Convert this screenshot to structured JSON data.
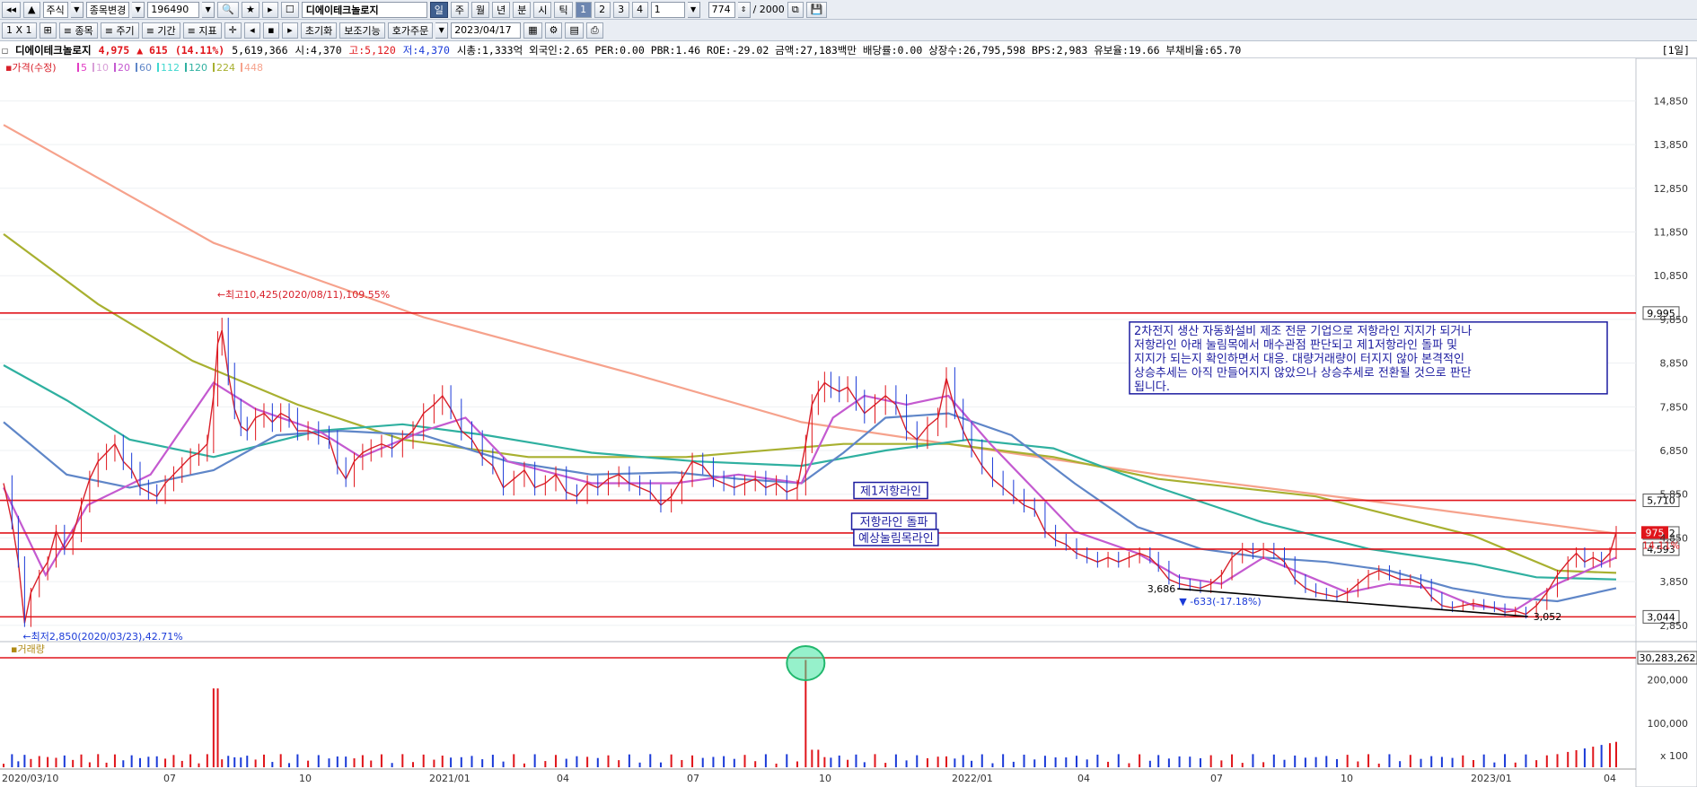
{
  "toolbar1": {
    "market": "주식",
    "change_label": "종목변경",
    "code": "196490",
    "name": "디에이테크놀로지",
    "periods": [
      "일",
      "주",
      "월",
      "년",
      "분",
      "시",
      "틱"
    ],
    "numbers": [
      "1",
      "2",
      "3",
      "4"
    ],
    "unit": "1",
    "count": "774",
    "total": "/ 2000"
  },
  "toolbar2": {
    "buttons": [
      "1 X 1",
      "≡ 종목",
      "≡ 주기",
      "≡ 기간",
      "≡ 지표"
    ],
    "reset_label": "초기화",
    "aux_label": "보조기능",
    "order_label": "호가주문",
    "date": "2023/04/17"
  },
  "info": {
    "name": "디에이테크놀로지",
    "price": "4,975",
    "change": "▲ 615",
    "pct": "(14.11%)",
    "volume": "5,619,366",
    "open": "시:4,370",
    "high": "고:5,120",
    "low": "저:4,370",
    "rest": "시총:1,333억 외국인:2.65 PER:0.00 PBR:1.46 ROE:-29.02 금액:27,183백만 배당률:0.00 상장수:26,795,598 BPS:2,983 유보율:19.66 부채비율:65.70",
    "period_tag": "[1일]"
  },
  "chart_data": {
    "type": "line",
    "title": "",
    "price_legend": "가격(수정)",
    "ma_legend": [
      {
        "name": "5",
        "color": "#e23cc4"
      },
      {
        "name": "10",
        "color": "#d9a0d8"
      },
      {
        "name": "20",
        "color": "#c45ad0"
      },
      {
        "name": "60",
        "color": "#5f86c8"
      },
      {
        "name": "112",
        "color": "#40d8d0"
      },
      {
        "name": "120",
        "color": "#2fb0a0"
      },
      {
        "name": "224",
        "color": "#a8b030"
      },
      {
        "name": "448",
        "color": "#f6a28c"
      }
    ],
    "volume_legend": "거래량",
    "x_ticks": [
      "2020/03/10",
      "07",
      "10",
      "2021/01",
      "04",
      "07",
      "10",
      "2022/01",
      "04",
      "07",
      "10",
      "2023/01",
      "04"
    ],
    "y_ticks": [
      "14,850",
      "13,850",
      "12,850",
      "11,850",
      "10,850",
      "9,850",
      "8,850",
      "7,850",
      "6,850",
      "5,850",
      "4,850",
      "3,850",
      "2,850"
    ],
    "ylim": [
      2600,
      15700
    ],
    "vol_ticks": [
      "200,000",
      "100,000",
      "x 100"
    ],
    "h_lines": [
      {
        "value": 9995,
        "label": "9,995"
      },
      {
        "value": 5710,
        "label": "5,710"
      },
      {
        "value": 4962,
        "label": "4,962"
      },
      {
        "value": 4593,
        "label": "4,593"
      },
      {
        "value": 3044,
        "label": "3,044"
      }
    ],
    "last_tag_value": "975",
    "last_tag_pct": "14.11%",
    "vol_hline_label": "30,283,262",
    "price_path": [
      [
        0,
        6100
      ],
      [
        8,
        5200
      ],
      [
        14,
        4300
      ],
      [
        20,
        2900
      ],
      [
        26,
        3600
      ],
      [
        34,
        4000
      ],
      [
        42,
        4300
      ],
      [
        50,
        5000
      ],
      [
        58,
        4600
      ],
      [
        66,
        4900
      ],
      [
        74,
        5600
      ],
      [
        82,
        6200
      ],
      [
        90,
        6600
      ],
      [
        98,
        6800
      ],
      [
        106,
        7000
      ],
      [
        114,
        6600
      ],
      [
        122,
        6400
      ],
      [
        130,
        6000
      ],
      [
        138,
        5900
      ],
      [
        146,
        5800
      ],
      [
        154,
        6100
      ],
      [
        162,
        6300
      ],
      [
        170,
        6500
      ],
      [
        178,
        6700
      ],
      [
        186,
        6800
      ],
      [
        194,
        7000
      ],
      [
        200,
        8100
      ],
      [
        204,
        9300
      ],
      [
        208,
        9600
      ],
      [
        214,
        8600
      ],
      [
        220,
        7800
      ],
      [
        226,
        7400
      ],
      [
        232,
        7300
      ],
      [
        240,
        7600
      ],
      [
        248,
        7700
      ],
      [
        256,
        7500
      ],
      [
        264,
        7700
      ],
      [
        272,
        7600
      ],
      [
        280,
        7300
      ],
      [
        290,
        7300
      ],
      [
        300,
        7200
      ],
      [
        310,
        7100
      ],
      [
        318,
        6500
      ],
      [
        326,
        6200
      ],
      [
        334,
        6600
      ],
      [
        342,
        6800
      ],
      [
        350,
        6900
      ],
      [
        360,
        7000
      ],
      [
        370,
        6900
      ],
      [
        380,
        7100
      ],
      [
        390,
        7300
      ],
      [
        400,
        7700
      ],
      [
        410,
        7900
      ],
      [
        418,
        8100
      ],
      [
        426,
        7800
      ],
      [
        436,
        7300
      ],
      [
        446,
        7100
      ],
      [
        456,
        6700
      ],
      [
        466,
        6500
      ],
      [
        476,
        6000
      ],
      [
        486,
        6200
      ],
      [
        496,
        6400
      ],
      [
        506,
        6000
      ],
      [
        516,
        6100
      ],
      [
        526,
        6300
      ],
      [
        536,
        5900
      ],
      [
        546,
        5800
      ],
      [
        556,
        6100
      ],
      [
        566,
        6000
      ],
      [
        576,
        6200
      ],
      [
        586,
        6300
      ],
      [
        596,
        6100
      ],
      [
        606,
        6000
      ],
      [
        616,
        5900
      ],
      [
        626,
        5600
      ],
      [
        636,
        5800
      ],
      [
        646,
        6200
      ],
      [
        656,
        6600
      ],
      [
        666,
        6500
      ],
      [
        676,
        6200
      ],
      [
        686,
        6100
      ],
      [
        696,
        6000
      ],
      [
        706,
        6100
      ],
      [
        716,
        6200
      ],
      [
        726,
        6000
      ],
      [
        736,
        6100
      ],
      [
        746,
        5900
      ],
      [
        756,
        6000
      ],
      [
        764,
        7000
      ],
      [
        770,
        7900
      ],
      [
        776,
        8200
      ],
      [
        782,
        8400
      ],
      [
        788,
        8300
      ],
      [
        796,
        8200
      ],
      [
        804,
        8300
      ],
      [
        812,
        8000
      ],
      [
        820,
        7700
      ],
      [
        830,
        7900
      ],
      [
        840,
        8100
      ],
      [
        850,
        7900
      ],
      [
        860,
        7300
      ],
      [
        870,
        7100
      ],
      [
        880,
        7400
      ],
      [
        890,
        7600
      ],
      [
        898,
        8500
      ],
      [
        906,
        7800
      ],
      [
        914,
        7300
      ],
      [
        922,
        6900
      ],
      [
        932,
        6500
      ],
      [
        942,
        6200
      ],
      [
        952,
        6000
      ],
      [
        962,
        5800
      ],
      [
        972,
        5600
      ],
      [
        982,
        5500
      ],
      [
        992,
        5000
      ],
      [
        1002,
        4800
      ],
      [
        1012,
        4700
      ],
      [
        1022,
        4500
      ],
      [
        1032,
        4400
      ],
      [
        1042,
        4300
      ],
      [
        1052,
        4400
      ],
      [
        1062,
        4300
      ],
      [
        1072,
        4400
      ],
      [
        1082,
        4500
      ],
      [
        1092,
        4400
      ],
      [
        1100,
        4200
      ],
      [
        1110,
        3900
      ],
      [
        1120,
        3800
      ],
      [
        1130,
        3750
      ],
      [
        1140,
        3700
      ],
      [
        1150,
        3800
      ],
      [
        1160,
        4000
      ],
      [
        1170,
        4400
      ],
      [
        1180,
        4600
      ],
      [
        1190,
        4500
      ],
      [
        1200,
        4600
      ],
      [
        1210,
        4500
      ],
      [
        1220,
        4300
      ],
      [
        1230,
        3900
      ],
      [
        1240,
        3700
      ],
      [
        1250,
        3600
      ],
      [
        1260,
        3550
      ],
      [
        1270,
        3500
      ],
      [
        1280,
        3600
      ],
      [
        1290,
        3800
      ],
      [
        1300,
        4000
      ],
      [
        1310,
        4100
      ],
      [
        1320,
        4000
      ],
      [
        1330,
        3900
      ],
      [
        1340,
        3900
      ],
      [
        1350,
        3800
      ],
      [
        1360,
        3500
      ],
      [
        1370,
        3300
      ],
      [
        1380,
        3250
      ],
      [
        1390,
        3300
      ],
      [
        1400,
        3350
      ],
      [
        1410,
        3300
      ],
      [
        1420,
        3250
      ],
      [
        1430,
        3150
      ],
      [
        1440,
        3180
      ],
      [
        1450,
        3100
      ],
      [
        1460,
        3300
      ],
      [
        1470,
        3600
      ],
      [
        1480,
        4000
      ],
      [
        1490,
        4300
      ],
      [
        1498,
        4500
      ],
      [
        1506,
        4300
      ],
      [
        1514,
        4400
      ],
      [
        1522,
        4300
      ],
      [
        1530,
        4500
      ],
      [
        1536,
        4975
      ]
    ],
    "ma_curves": [
      {
        "name": "448",
        "color": "#f6a28c",
        "points": [
          [
            0,
            14300
          ],
          [
            200,
            11600
          ],
          [
            400,
            9900
          ],
          [
            600,
            8600
          ],
          [
            760,
            7500
          ],
          [
            900,
            7000
          ],
          [
            1100,
            6300
          ],
          [
            1300,
            5700
          ],
          [
            1536,
            4950
          ]
        ]
      },
      {
        "name": "224",
        "color": "#a8b030",
        "points": [
          [
            0,
            11800
          ],
          [
            90,
            10200
          ],
          [
            180,
            8900
          ],
          [
            280,
            7900
          ],
          [
            380,
            7100
          ],
          [
            500,
            6700
          ],
          [
            650,
            6700
          ],
          [
            800,
            7000
          ],
          [
            900,
            7000
          ],
          [
            1000,
            6700
          ],
          [
            1100,
            6200
          ],
          [
            1250,
            5800
          ],
          [
            1400,
            4900
          ],
          [
            1480,
            4100
          ],
          [
            1536,
            4050
          ]
        ]
      },
      {
        "name": "120",
        "color": "#2fb0a0",
        "points": [
          [
            0,
            8800
          ],
          [
            60,
            8000
          ],
          [
            120,
            7100
          ],
          [
            200,
            6700
          ],
          [
            300,
            7300
          ],
          [
            380,
            7450
          ],
          [
            460,
            7200
          ],
          [
            560,
            6800
          ],
          [
            660,
            6600
          ],
          [
            760,
            6500
          ],
          [
            840,
            6850
          ],
          [
            920,
            7100
          ],
          [
            1000,
            6900
          ],
          [
            1100,
            6000
          ],
          [
            1200,
            5200
          ],
          [
            1300,
            4600
          ],
          [
            1400,
            4250
          ],
          [
            1460,
            3950
          ],
          [
            1536,
            3900
          ]
        ]
      },
      {
        "name": "60",
        "color": "#5f86c8",
        "points": [
          [
            0,
            7500
          ],
          [
            60,
            6300
          ],
          [
            120,
            6000
          ],
          [
            200,
            6400
          ],
          [
            260,
            7200
          ],
          [
            320,
            7300
          ],
          [
            400,
            7200
          ],
          [
            480,
            6600
          ],
          [
            560,
            6300
          ],
          [
            640,
            6350
          ],
          [
            700,
            6200
          ],
          [
            760,
            6100
          ],
          [
            800,
            6800
          ],
          [
            840,
            7600
          ],
          [
            900,
            7700
          ],
          [
            960,
            7200
          ],
          [
            1020,
            6100
          ],
          [
            1080,
            5100
          ],
          [
            1140,
            4600
          ],
          [
            1200,
            4400
          ],
          [
            1260,
            4300
          ],
          [
            1320,
            4100
          ],
          [
            1380,
            3700
          ],
          [
            1430,
            3500
          ],
          [
            1480,
            3400
          ],
          [
            1536,
            3700
          ]
        ]
      },
      {
        "name": "20",
        "color": "#c45ad0",
        "points": [
          [
            0,
            6000
          ],
          [
            40,
            4000
          ],
          [
            80,
            5600
          ],
          [
            140,
            6300
          ],
          [
            200,
            8400
          ],
          [
            240,
            7800
          ],
          [
            300,
            7300
          ],
          [
            340,
            6700
          ],
          [
            400,
            7300
          ],
          [
            440,
            7600
          ],
          [
            480,
            6600
          ],
          [
            560,
            6100
          ],
          [
            640,
            6100
          ],
          [
            700,
            6300
          ],
          [
            760,
            6100
          ],
          [
            790,
            7600
          ],
          [
            820,
            8100
          ],
          [
            860,
            7900
          ],
          [
            900,
            8100
          ],
          [
            940,
            7000
          ],
          [
            980,
            6000
          ],
          [
            1020,
            5000
          ],
          [
            1080,
            4500
          ],
          [
            1120,
            3950
          ],
          [
            1160,
            3800
          ],
          [
            1200,
            4400
          ],
          [
            1240,
            4000
          ],
          [
            1280,
            3600
          ],
          [
            1320,
            3800
          ],
          [
            1360,
            3700
          ],
          [
            1400,
            3300
          ],
          [
            1440,
            3200
          ],
          [
            1480,
            3800
          ],
          [
            1536,
            4400
          ]
        ]
      }
    ],
    "annotations": {
      "high": "←최고10,425(2020/08/11),109.55%",
      "low": "←최저2,850(2020/03/23),42.71%",
      "point_a": "3,686",
      "point_a_change": "▼ -633(-17.18%)",
      "point_b": "3,052",
      "box1": "제1저항라인",
      "box2": "저항라인 돌파",
      "box3": "예상눌림목라인",
      "note_lines": [
        "2차전지 생산 자동화설비 제조 전문 기업으로 저항라인 지지가 되거나",
        "저항라인 아래 눌림목에서 매수관점 판단되고 제1저항라인 돌파 및",
        "지지가 되는지 확인하면서 대응. 대량거래량이 터지지 않아 본격적인",
        "상승추세는 아직 만들어지지 않았으나 상승추세로 전환될 것으로 판단",
        "됩니다."
      ]
    }
  }
}
